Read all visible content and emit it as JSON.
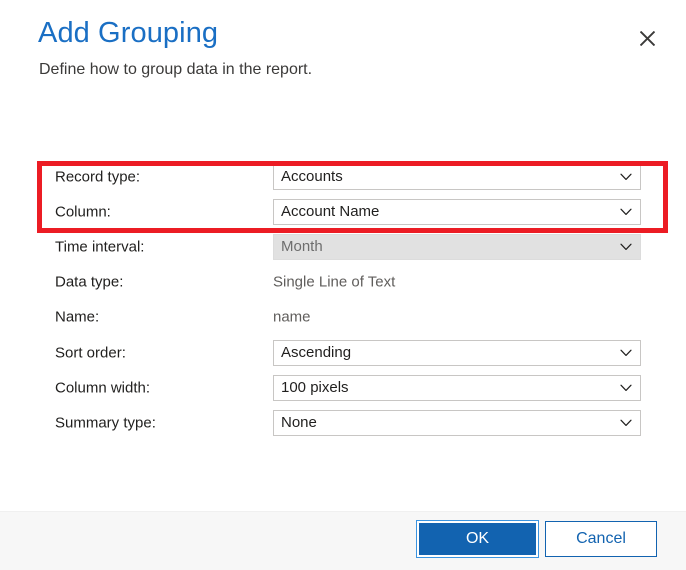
{
  "dialog": {
    "title": "Add Grouping",
    "subtitle": "Define how to group data in the report.",
    "close_icon": "close-icon"
  },
  "colors": {
    "title_blue": "#1a6fc4",
    "accent_blue": "#1263b0",
    "required_red": "#d62d20",
    "annotation_red": "#ec1c24",
    "footer_bg": "#f7f7f7",
    "disabled_bg": "#e1e1e1"
  },
  "form": {
    "rows": [
      {
        "label": "Record type:",
        "required": true,
        "required_marker": "*",
        "kind": "combo",
        "value": "Accounts",
        "disabled": false,
        "icon": "chevron-down-icon"
      },
      {
        "label": "Column:",
        "required": true,
        "required_marker": "*",
        "kind": "combo",
        "value": "Account Name",
        "disabled": false,
        "icon": "chevron-down-icon"
      },
      {
        "label": "Time interval:",
        "required": false,
        "required_marker": "",
        "kind": "combo",
        "value": "Month",
        "disabled": true,
        "icon": "chevron-down-icon"
      },
      {
        "label": "Data type:",
        "required": false,
        "required_marker": "",
        "kind": "static",
        "value": "Single Line of Text",
        "disabled": false,
        "icon": ""
      },
      {
        "label": "Name:",
        "required": false,
        "required_marker": "",
        "kind": "static",
        "value": "name",
        "disabled": false,
        "icon": ""
      },
      {
        "label": "Sort order:",
        "required": false,
        "required_marker": "",
        "kind": "combo",
        "value": "Ascending",
        "disabled": false,
        "icon": "chevron-down-icon"
      },
      {
        "label": "Column width:",
        "required": true,
        "required_marker": "*",
        "kind": "combo",
        "value": "100 pixels",
        "disabled": false,
        "icon": "chevron-down-icon"
      },
      {
        "label": "Summary type:",
        "required": false,
        "required_marker": "",
        "kind": "combo",
        "value": "None",
        "disabled": false,
        "icon": "chevron-down-icon"
      }
    ]
  },
  "footer": {
    "ok_label": "OK",
    "cancel_label": "Cancel"
  },
  "annotations": [
    {
      "name": "required-fields-highlight"
    },
    {
      "name": "ok-button-highlight"
    }
  ]
}
